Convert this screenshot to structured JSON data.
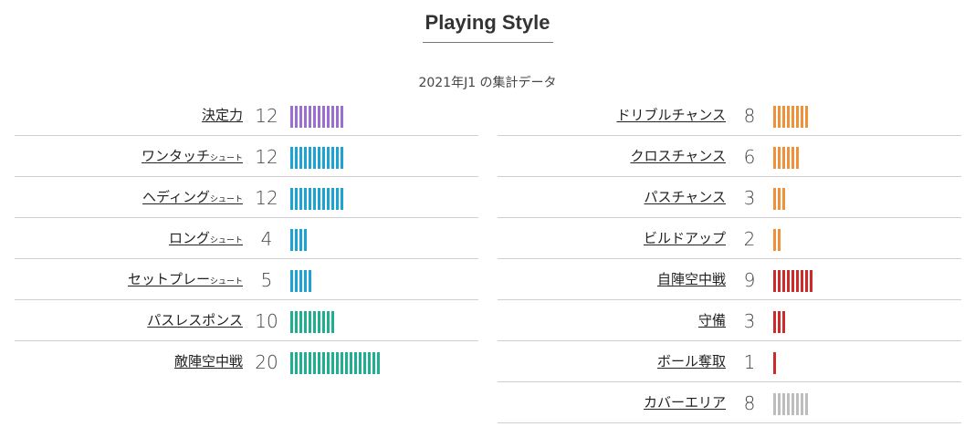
{
  "header": {
    "title": "Playing Style",
    "subtitle": "2021年J1 の集計データ"
  },
  "colors": {
    "purple": "#9b6fd1",
    "blue": "#1ba3d3",
    "teal": "#1fae8f",
    "orange": "#f0913a",
    "red": "#cf2a2a",
    "gray": "#bdbdbd"
  },
  "left_stats": [
    {
      "label": "決定力",
      "suffix": "",
      "value": "12",
      "count": 12,
      "color": "#9b6fd1"
    },
    {
      "label": "ワンタッチ",
      "suffix": "シュート",
      "value": "12",
      "count": 12,
      "color": "#1ba3d3"
    },
    {
      "label": "ヘディング",
      "suffix": "シュート",
      "value": "12",
      "count": 12,
      "color": "#1ba3d3"
    },
    {
      "label": "ロング",
      "suffix": "シュート",
      "value": "4",
      "count": 4,
      "color": "#1ba3d3"
    },
    {
      "label": "セットプレー",
      "suffix": "シュート",
      "value": "5",
      "count": 5,
      "color": "#1ba3d3"
    },
    {
      "label": "パスレスポンス",
      "suffix": "",
      "value": "10",
      "count": 10,
      "color": "#1fae8f"
    },
    {
      "label": "敵陣空中戦",
      "suffix": "",
      "value": "20",
      "count": 20,
      "color": "#1fae8f"
    }
  ],
  "right_stats": [
    {
      "label": "ドリブルチャンス",
      "suffix": "",
      "value": "8",
      "count": 8,
      "color": "#f0913a"
    },
    {
      "label": "クロスチャンス",
      "suffix": "",
      "value": "6",
      "count": 6,
      "color": "#f0913a"
    },
    {
      "label": "パスチャンス",
      "suffix": "",
      "value": "3",
      "count": 3,
      "color": "#f0913a"
    },
    {
      "label": "ビルドアップ",
      "suffix": "",
      "value": "2",
      "count": 2,
      "color": "#f0913a"
    },
    {
      "label": "自陣空中戦",
      "suffix": "",
      "value": "9",
      "count": 9,
      "color": "#cf2a2a"
    },
    {
      "label": "守備",
      "suffix": "",
      "value": "3",
      "count": 3,
      "color": "#cf2a2a"
    },
    {
      "label": "ボール奪取",
      "suffix": "",
      "value": "1",
      "count": 1,
      "color": "#cf2a2a"
    },
    {
      "label": "カバーエリア",
      "suffix": "",
      "value": "8",
      "count": 8,
      "color": "#bdbdbd"
    }
  ]
}
